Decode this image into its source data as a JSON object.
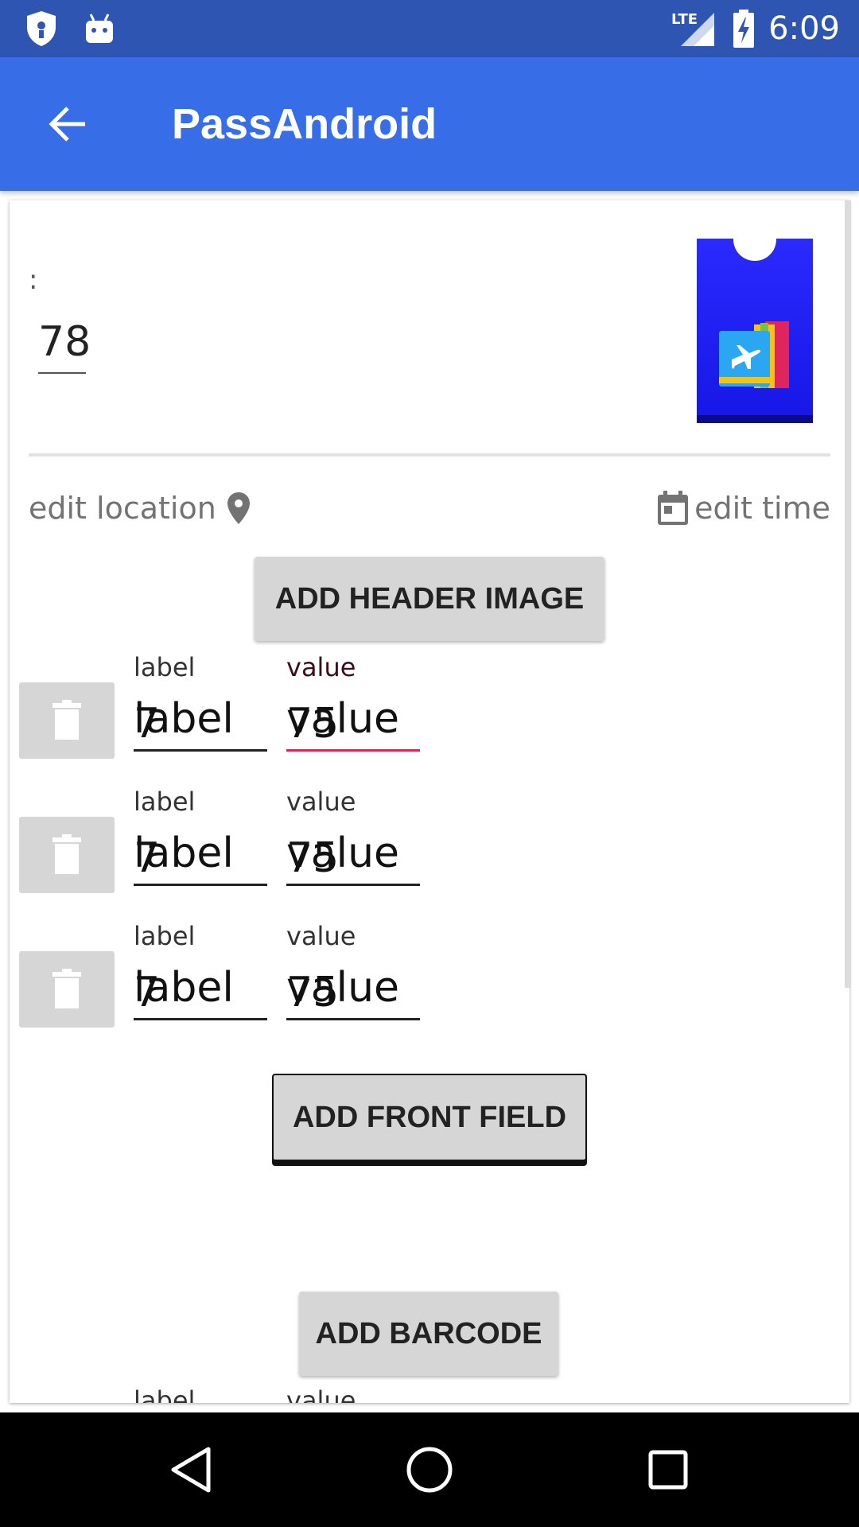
{
  "status_bar": {
    "time": "6:09",
    "network": "LTE",
    "icons": [
      "shield-icon",
      "android-icon",
      "signal-icon",
      "battery-charging-icon"
    ]
  },
  "app_bar": {
    "title": "PassAndroid",
    "back_icon": "arrow-back-icon"
  },
  "editor": {
    "description_prefix": ":",
    "description_value": "78",
    "edit_location_label": "edit location",
    "edit_time_label": "edit time",
    "add_header_image_label": "ADD HEADER IMAGE",
    "front_fields": [
      {
        "label_caption": "label",
        "label_value": "label",
        "label_overlay": "7",
        "value_caption": "value",
        "value_value": "value",
        "value_overlay": "75",
        "focused": true
      },
      {
        "label_caption": "label",
        "label_value": "label",
        "label_overlay": "7",
        "value_caption": "value",
        "value_value": "value",
        "value_overlay": "75",
        "focused": false
      },
      {
        "label_caption": "label",
        "label_value": "label",
        "label_overlay": "7",
        "value_caption": "value",
        "value_value": "value",
        "value_overlay": "75",
        "focused": false
      }
    ],
    "add_front_field_label": "ADD FRONT FIELD",
    "add_barcode_label": "ADD BARCODE",
    "cut_label_caption": "label",
    "cut_value_caption": "value"
  },
  "colors": {
    "status_bar": "#2f55b3",
    "app_bar": "#386de8",
    "focus_underline": "#e0245e",
    "button_bg": "#d6d6d6"
  }
}
